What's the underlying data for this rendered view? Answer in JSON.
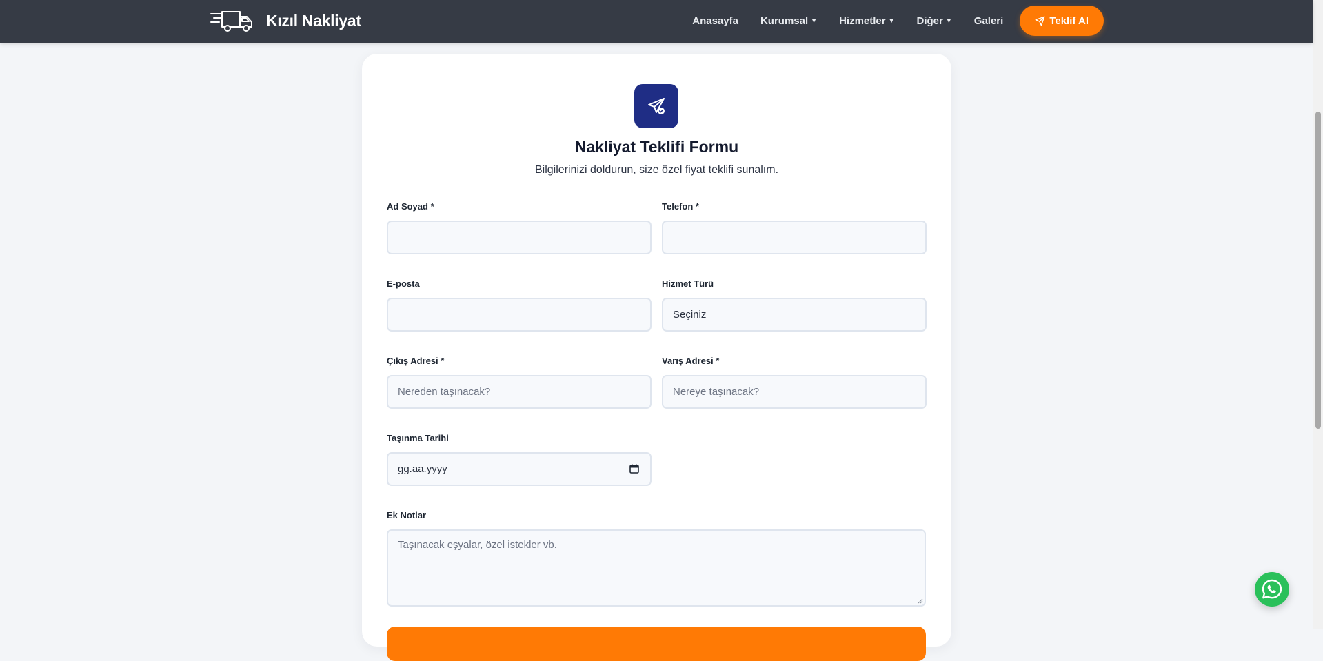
{
  "brand": {
    "name": "Kızıl Nakliyat",
    "logo_icon": "moving-truck-icon"
  },
  "nav": {
    "items": [
      {
        "label": "Anasayfa",
        "has_dropdown": false
      },
      {
        "label": "Kurumsal",
        "has_dropdown": true
      },
      {
        "label": "Hizmetler",
        "has_dropdown": true
      },
      {
        "label": "Diğer",
        "has_dropdown": true
      },
      {
        "label": "Galeri",
        "has_dropdown": false
      }
    ],
    "cta_label": "Teklif Al",
    "cta_icon": "paper-plane-icon"
  },
  "form": {
    "icon": "paper-plane-check-icon",
    "title": "Nakliyat Teklifi Formu",
    "subtitle": "Bilgilerinizi doldurun, size özel fiyat teklifi sunalım.",
    "fields": {
      "name": {
        "label": "Ad Soyad *",
        "value": ""
      },
      "phone": {
        "label": "Telefon *",
        "value": ""
      },
      "email": {
        "label": "E-posta",
        "value": ""
      },
      "service": {
        "label": "Hizmet Türü",
        "value": "Seçiniz"
      },
      "origin": {
        "label": "Çıkış Adresi *",
        "placeholder": "Nereden taşınacak?"
      },
      "destination": {
        "label": "Varış Adresi *",
        "placeholder": "Nereye taşınacak?"
      },
      "date": {
        "label": "Taşınma Tarihi",
        "value": "gg.aa.yyyy"
      },
      "notes": {
        "label": "Ek Notlar",
        "placeholder": "Taşınacak eşyalar, özel istekler vb."
      }
    }
  },
  "colors": {
    "navbar_bg": "#363b45",
    "accent": "#ff7a05",
    "form_icon_bg": "#1f2d85",
    "whatsapp": "#2ac05a"
  },
  "floating": {
    "whatsapp_icon": "whatsapp-icon"
  }
}
